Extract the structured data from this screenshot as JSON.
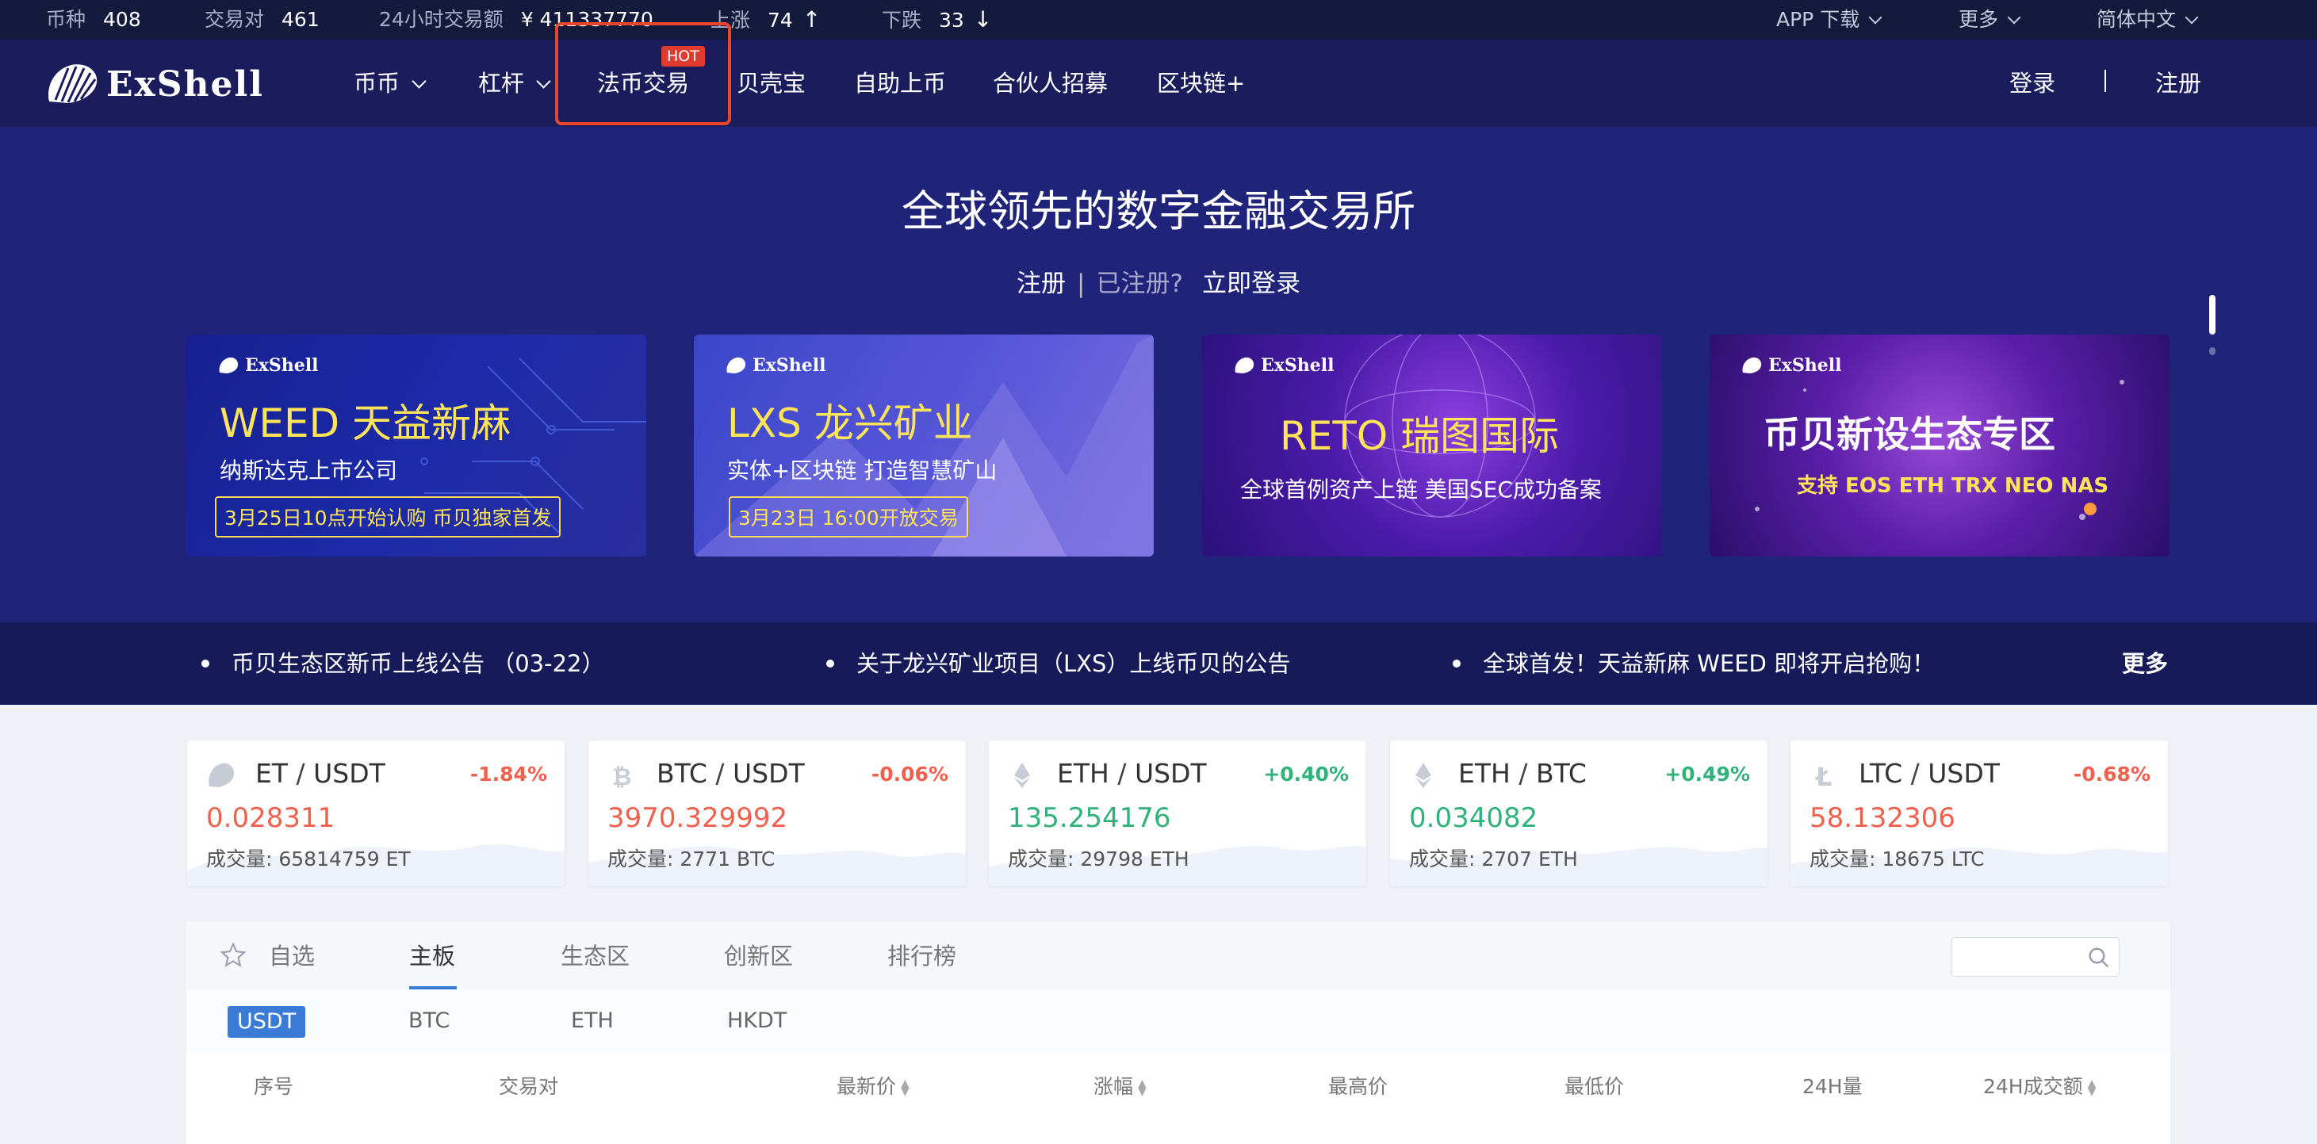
{
  "stats": {
    "coins_label": "币种",
    "coins_value": "408",
    "pairs_label": "交易对",
    "pairs_value": "461",
    "volume_label": "24小时交易额",
    "volume_value": "¥ 411337770",
    "up_label": "上涨",
    "up_value": "74",
    "up_arrow": "↑",
    "down_label": "下跌",
    "down_value": "33",
    "down_arrow": "↓",
    "app_download": "APP 下载",
    "more": "更多",
    "language": "简体中文"
  },
  "nav": {
    "logo_text": "ExShell",
    "items": [
      "币币",
      "杠杆",
      "法币交易",
      "贝壳宝",
      "自助上币",
      "合伙人招募",
      "区块链+"
    ],
    "hot_badge": "HOT",
    "login": "登录",
    "register": "注册"
  },
  "hero": {
    "title": "全球领先的数字金融交易所",
    "register": "注册",
    "separator": "|",
    "registered_q": "已注册?",
    "login_now": "立即登录"
  },
  "banners": [
    {
      "logo": "ExShell",
      "title": "WEED 天益新麻",
      "subtitle": "纳斯达克上市公司",
      "box": "3月25日10点开始认购  币贝独家首发"
    },
    {
      "logo": "ExShell",
      "title": "LXS 龙兴矿业",
      "subtitle": "实体+区块链  打造智慧矿山",
      "box": "3月23日 16:00开放交易"
    },
    {
      "logo": "ExShell",
      "title": "RETO 瑞图国际",
      "subtitle": "全球首例资产上链  美国SEC成功备案"
    },
    {
      "logo": "ExShell",
      "title": "币贝新设生态专区",
      "subtitle": "支持 EOS ETH TRX NEO NAS"
    }
  ],
  "announcements": {
    "items": [
      "币贝生态区新币上线公告 （03-22）",
      "关于龙兴矿业项目（LXS）上线币贝的公告",
      "全球首发！天益新麻 WEED 即将开启抢购！"
    ],
    "more": "更多"
  },
  "tickers": [
    {
      "base": "ET",
      "quote": "USDT",
      "change": "-1.84%",
      "price": "0.028311",
      "volume": "成交量: 65814759 ET",
      "icon": "exshell-icon"
    },
    {
      "base": "BTC",
      "quote": "USDT",
      "change": "-0.06%",
      "price": "3970.329992",
      "volume": "成交量: 2771 BTC",
      "icon": "bitcoin-icon"
    },
    {
      "base": "ETH",
      "quote": "USDT",
      "change": "+0.40%",
      "price": "135.254176",
      "volume": "成交量: 29798 ETH",
      "icon": "ethereum-icon"
    },
    {
      "base": "ETH",
      "quote": "BTC",
      "change": "+0.49%",
      "price": "0.034082",
      "volume": "成交量: 2707 ETH",
      "icon": "ethereum-icon"
    },
    {
      "base": "LTC",
      "quote": "USDT",
      "change": "-0.68%",
      "price": "58.132306",
      "volume": "成交量: 18675 LTC",
      "icon": "litecoin-icon"
    }
  ],
  "pair_separator": "/",
  "market": {
    "tabs": [
      "自选",
      "主板",
      "生态区",
      "创新区",
      "排行榜"
    ],
    "subtabs": [
      "USDT",
      "BTC",
      "ETH",
      "HKDT"
    ],
    "columns": [
      "序号",
      "交易对",
      "最新价",
      "涨幅",
      "最高价",
      "最低价",
      "24H量",
      "24H成交额"
    ]
  },
  "colors": {
    "negative": "#f0614d",
    "positive": "#2fb37a",
    "accent": "#3a7bd5",
    "hot": "#e03b2f"
  }
}
